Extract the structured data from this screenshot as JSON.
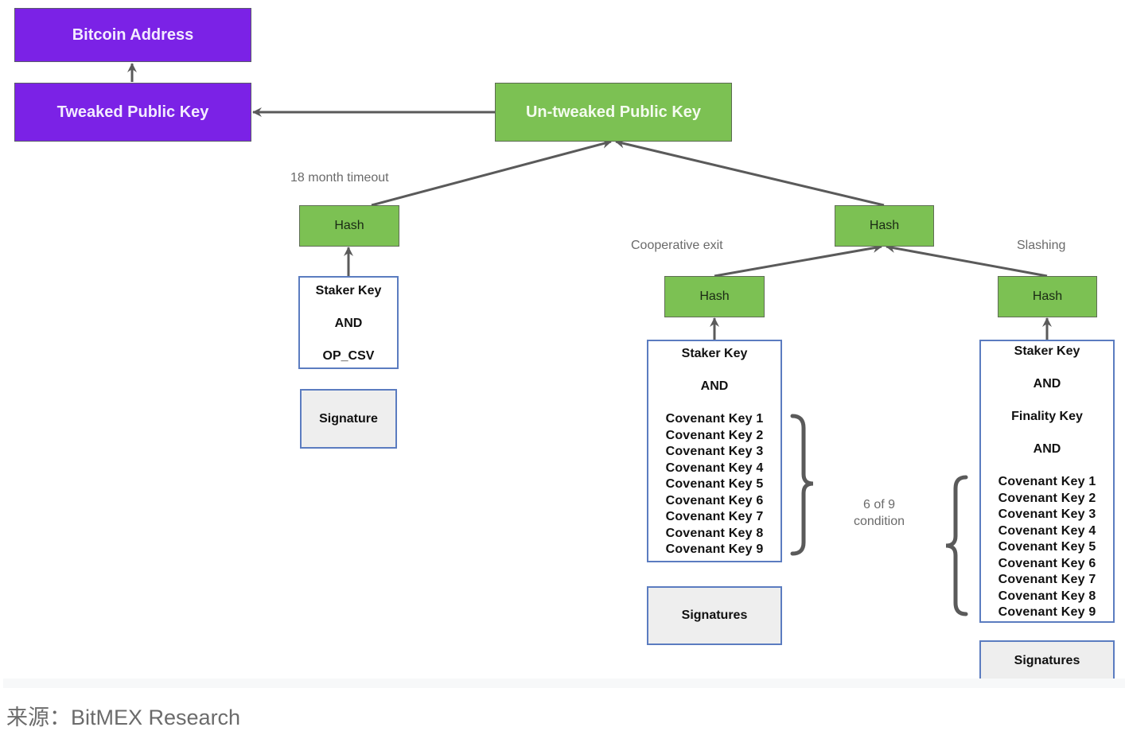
{
  "nodes": {
    "bitcoin_address": "Bitcoin Address",
    "tweaked_key": "Tweaked Public Key",
    "untweaked_key": "Un-tweaked Public Key",
    "hash_timeout": "Hash",
    "hash_right": "Hash",
    "hash_coop": "Hash",
    "hash_slash": "Hash"
  },
  "branches": {
    "timeout": {
      "label": "18 month timeout",
      "conditions": [
        "Staker Key",
        "AND",
        "OP_CSV"
      ],
      "witness": "Signature"
    },
    "cooperative": {
      "label": "Cooperative exit",
      "conditions": [
        "Staker Key",
        "AND"
      ],
      "covenant_keys": [
        "Covenant Key 1",
        "Covenant Key 2",
        "Covenant Key 3",
        "Covenant Key 4",
        "Covenant Key 5",
        "Covenant Key 6",
        "Covenant Key 7",
        "Covenant Key 8",
        "Covenant Key 9"
      ],
      "witness": "Signatures"
    },
    "slashing": {
      "label": "Slashing",
      "conditions": [
        "Staker Key",
        "AND",
        "Finality Key",
        "AND"
      ],
      "covenant_keys": [
        "Covenant Key 1",
        "Covenant Key 2",
        "Covenant Key 3",
        "Covenant Key 4",
        "Covenant Key 5",
        "Covenant Key 6",
        "Covenant Key 7",
        "Covenant Key 8",
        "Covenant Key 9"
      ],
      "witness": "Signatures"
    }
  },
  "threshold_note": [
    "6 of 9",
    "condition"
  ],
  "colors": {
    "purple": "#7b22e6",
    "green": "#7cc153",
    "blue_border": "#5b7cc0",
    "arrow": "#5a5a5a"
  },
  "source": "来源：BitMEX Research"
}
